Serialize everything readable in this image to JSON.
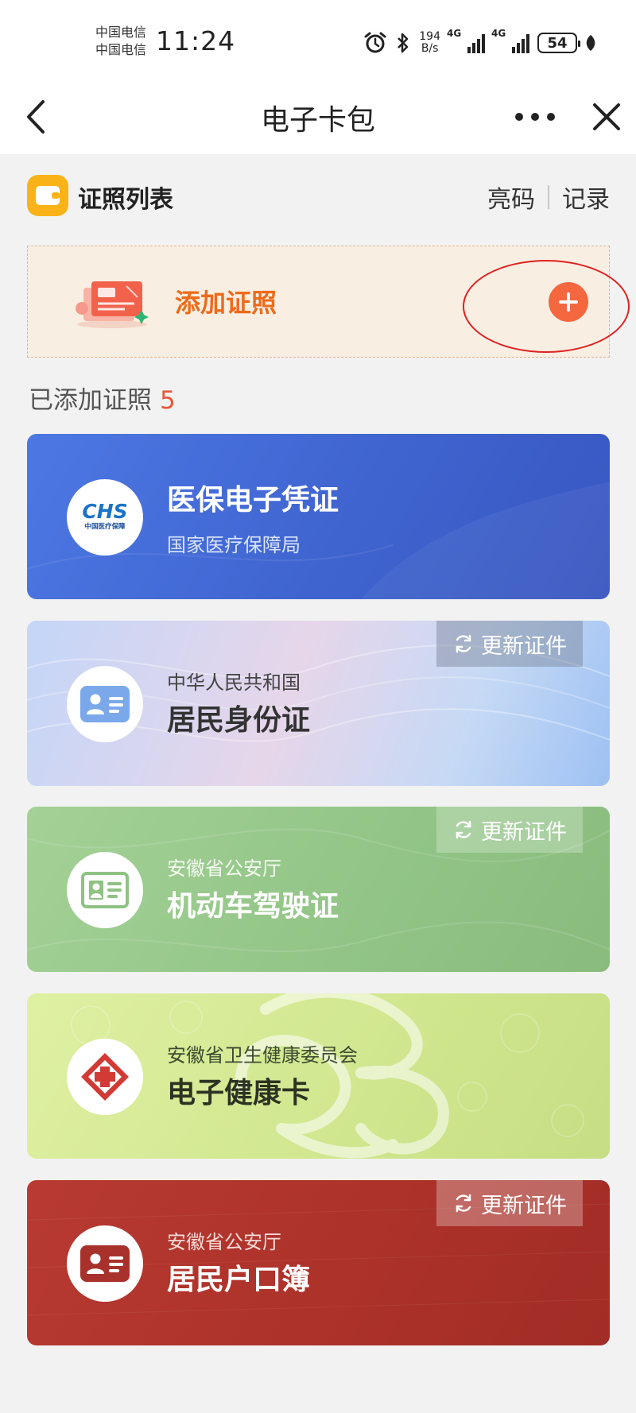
{
  "status_bar": {
    "carrier_1": "中国电信",
    "carrier_2": "中国电信",
    "time": "11:24",
    "net_speed_value": "194",
    "net_speed_unit": "B/s",
    "signal_1": "4G",
    "signal_2": "4G",
    "battery": "54"
  },
  "nav": {
    "title": "电子卡包",
    "back_icon": "chevron-left-icon",
    "more_icon": "more-dots-icon",
    "close_icon": "close-icon"
  },
  "list_header": {
    "icon": "wallet-icon",
    "title": "证照列表",
    "link_qr": "亮码",
    "link_records": "记录"
  },
  "add_banner": {
    "label": "添加证照",
    "icon": "plus-icon",
    "accent": "#ee6a1a"
  },
  "added": {
    "label": "已添加证照",
    "count": "5"
  },
  "cards": [
    {
      "title": "医保电子凭证",
      "issuer": "国家医疗保障局",
      "badge_text": "CHS",
      "badge_caption": "中国医疗保障",
      "icon": "chs-logo-icon",
      "color": "#4466d4"
    },
    {
      "title": "居民身份证",
      "issuer": "中华人民共和国",
      "update_label": "更新证件",
      "icon": "id-card-icon",
      "color": "#c9d9f6"
    },
    {
      "title": "机动车驾驶证",
      "issuer": "安徽省公安厅",
      "update_label": "更新证件",
      "icon": "license-card-icon",
      "color": "#93c588"
    },
    {
      "title": "电子健康卡",
      "issuer": "安徽省卫生健康委员会",
      "icon": "red-cross-icon",
      "color": "#d5e992"
    },
    {
      "title": "居民户口簿",
      "issuer": "安徽省公安厅",
      "update_label": "更新证件",
      "icon": "household-card-icon",
      "color": "#ad322a"
    }
  ]
}
